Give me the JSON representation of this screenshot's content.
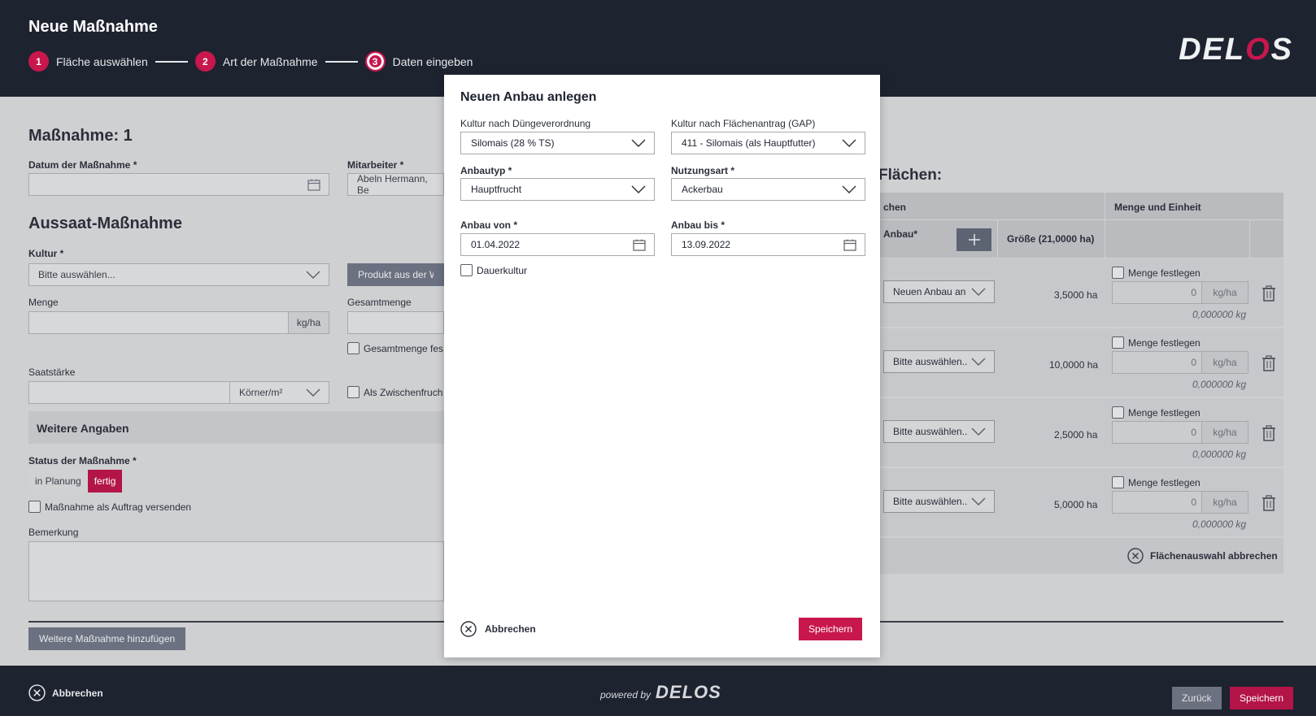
{
  "header": {
    "title": "Neue Maßnahme",
    "steps": [
      {
        "num": "1",
        "label": "Fläche auswählen"
      },
      {
        "num": "2",
        "label": "Art der Maßnahme"
      },
      {
        "num": "3",
        "label": "Daten eingeben"
      }
    ],
    "logo_pre": "DEL",
    "logo_o": "O",
    "logo_post": "S"
  },
  "form": {
    "section_title": "Maßnahme: 1",
    "date_label": "Datum der Maßnahme *",
    "date_value": "",
    "employee_label": "Mitarbeiter *",
    "employee_value": "Abeln Hermann, Be",
    "aussaat_title": "Aussaat-Maßnahme",
    "kultur_label": "Kultur *",
    "kultur_value": "Bitte auswählen...",
    "product_button": "Produkt aus der Wa",
    "menge_label": "Menge",
    "menge_unit": "kg/ha",
    "gesamtmenge_label": "Gesamtmenge",
    "gesamtmenge_checkbox": "Gesamtmenge fes",
    "saatstaerke_label": "Saatstärke",
    "saatstaerke_unit": "Körner/m²",
    "zwischenfrucht_checkbox": "Als Zwischenfruch",
    "weitere_angaben": "Weitere Angaben",
    "status_label": "Status der Maßnahme *",
    "status_options": [
      "in Planung",
      "fertig"
    ],
    "status_selected": "fertig",
    "auftrag_checkbox": "Maßnahme als Auftrag versenden",
    "bemerkung_label": "Bemerkung",
    "add_button": "Weitere Maßnahme hinzufügen"
  },
  "right_panel": {
    "title": "Flächen:",
    "col_flaechen": "chen",
    "col_menge": "Menge und Einheit",
    "col_anbau": "Anbau*",
    "col_groesse": "Größe (21,0000 ha)",
    "rows": [
      {
        "anbau": "Neuen Anbau an",
        "groesse": "3,5000 ha",
        "menge_label": "Menge festlegen",
        "menge": "0",
        "unit": "kg/ha",
        "kg": "0,000000 kg"
      },
      {
        "anbau": "Bitte auswählen..",
        "groesse": "10,0000 ha",
        "menge_label": "Menge festlegen",
        "menge": "0",
        "unit": "kg/ha",
        "kg": "0,000000 kg"
      },
      {
        "anbau": "Bitte auswählen..",
        "groesse": "2,5000 ha",
        "menge_label": "Menge festlegen",
        "menge": "0",
        "unit": "kg/ha",
        "kg": "0,000000 kg"
      },
      {
        "anbau": "Bitte auswählen..",
        "groesse": "5,0000 ha",
        "menge_label": "Menge festlegen",
        "menge": "0",
        "unit": "kg/ha",
        "kg": "0,000000 kg"
      }
    ],
    "cancel_selection": "Flächenauswahl abbrechen"
  },
  "footer": {
    "cancel": "Abbrechen",
    "powered_by": "powered by",
    "powered_logo": "DELOS",
    "back": "Zurück",
    "save": "Speichern"
  },
  "modal": {
    "title": "Neuen Anbau anlegen",
    "kultur_dvo_label": "Kultur nach Düngeverordnung",
    "kultur_dvo_value": "Silomais (28 % TS)",
    "kultur_gap_label": "Kultur nach Flächenantrag (GAP)",
    "kultur_gap_value": "411 - Silomais (als Hauptfutter)",
    "anbautyp_label": "Anbautyp *",
    "anbautyp_value": "Hauptfrucht",
    "nutzungsart_label": "Nutzungsart *",
    "nutzungsart_value": "Ackerbau",
    "anbau_von_label": "Anbau von *",
    "anbau_von_value": "01.04.2022",
    "anbau_bis_label": "Anbau bis *",
    "anbau_bis_value": "13.09.2022",
    "dauerkultur": "Dauerkultur",
    "cancel": "Abbrechen",
    "save": "Speichern"
  },
  "colors": {
    "header_bg": "#1e2330",
    "accent": "#c8174d",
    "overlay_bg": "#cfd0d2"
  }
}
